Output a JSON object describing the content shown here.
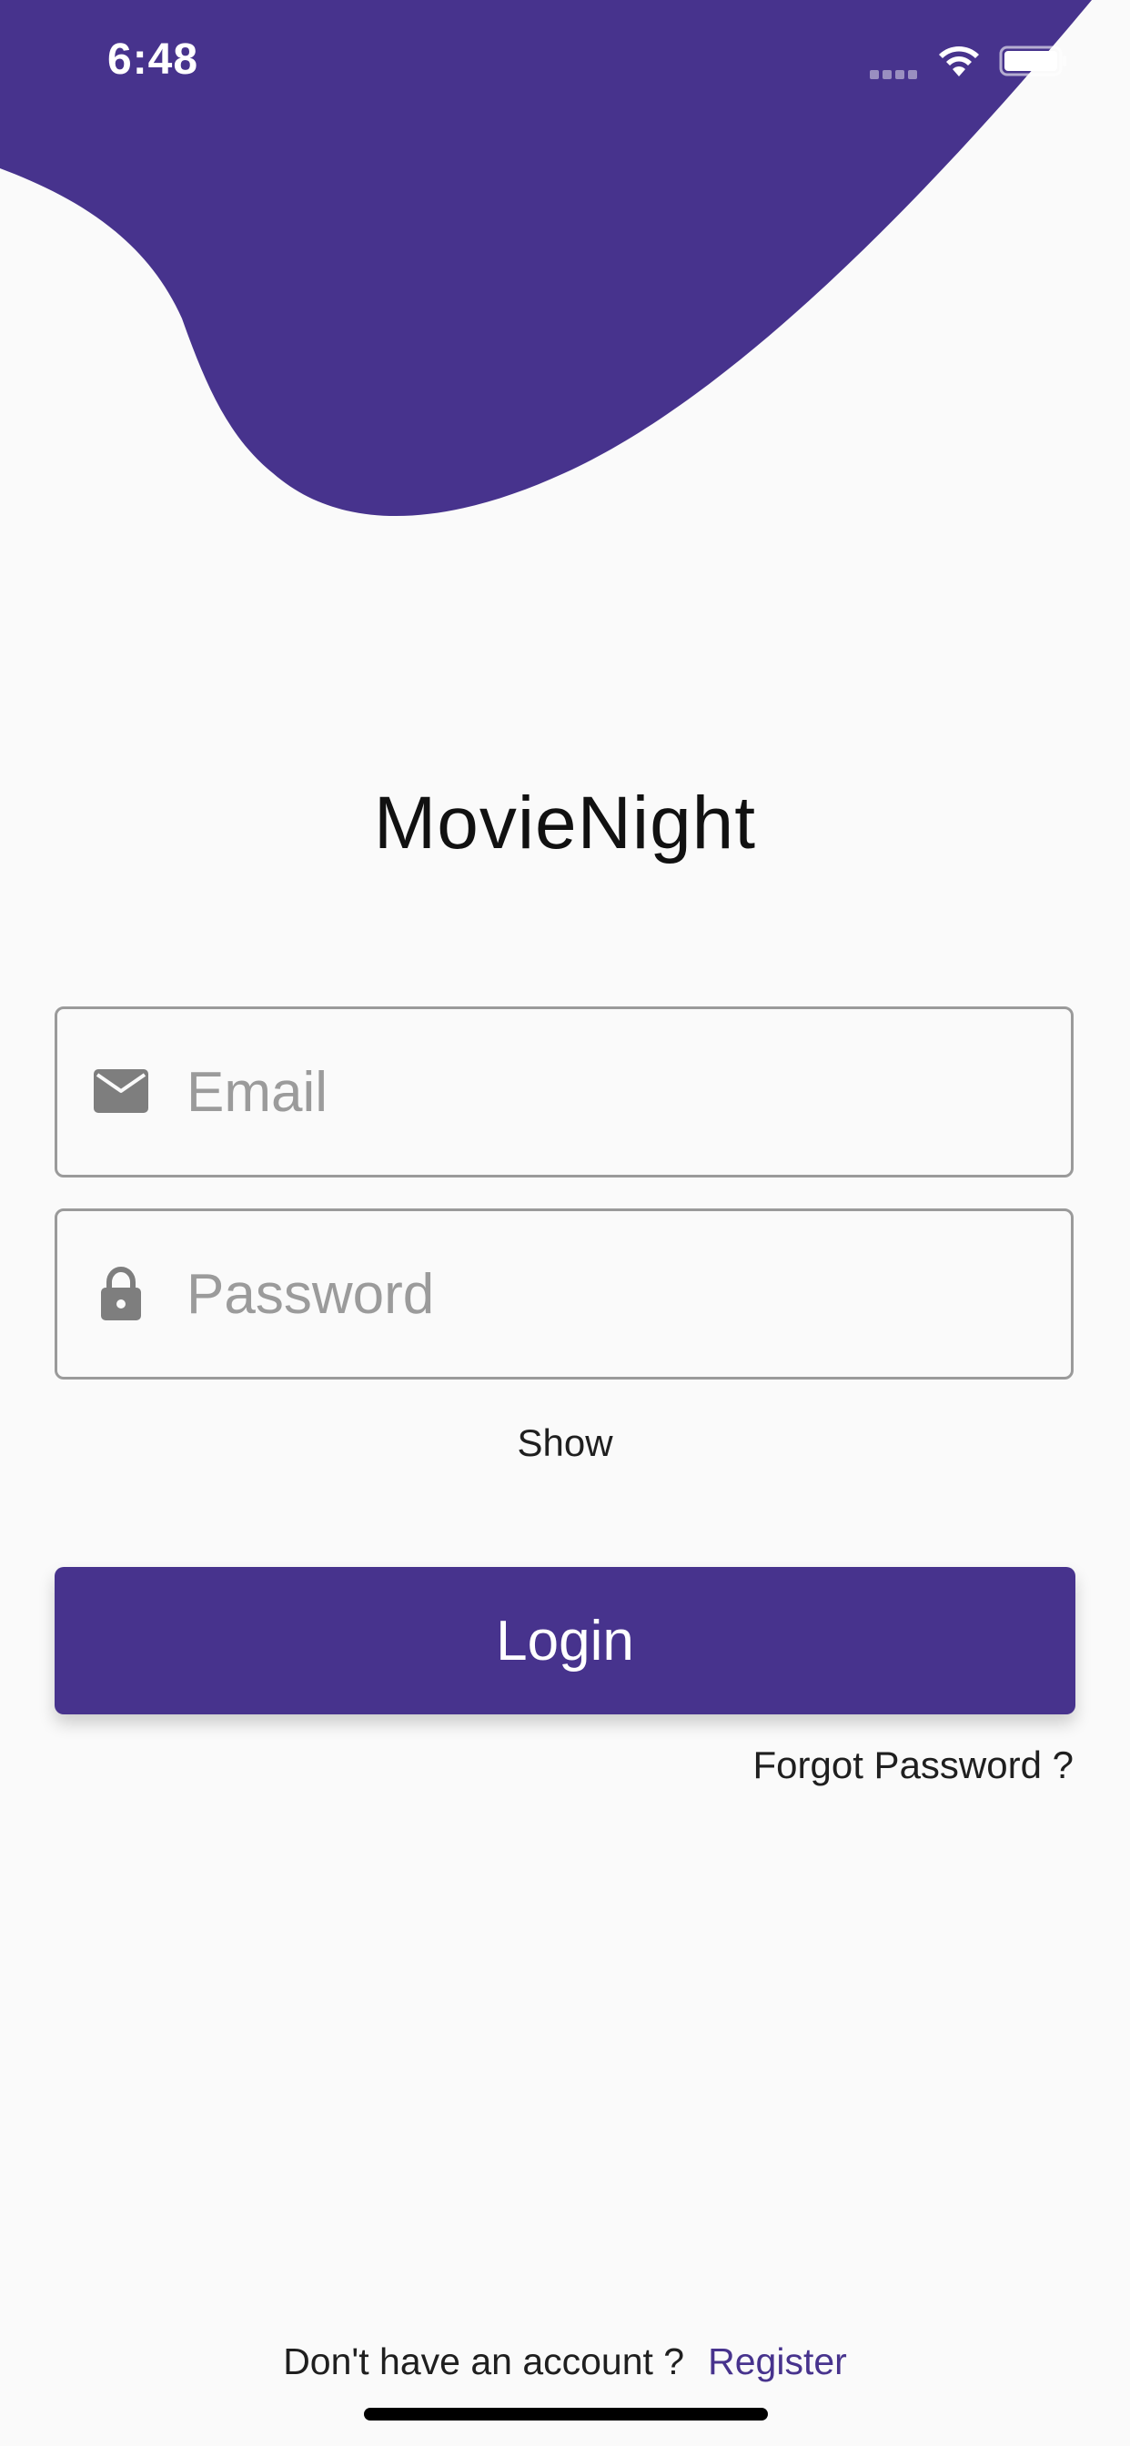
{
  "status_bar": {
    "time": "6:48"
  },
  "app": {
    "title": "MovieNight"
  },
  "form": {
    "email": {
      "placeholder": "Email",
      "value": "",
      "icon": "email-icon"
    },
    "password": {
      "placeholder": "Password",
      "value": "",
      "icon": "lock-icon"
    },
    "show_label": "Show",
    "login_label": "Login",
    "forgot_label": "Forgot Password ?"
  },
  "footer": {
    "prompt": "Don't have an account ?",
    "register_label": "Register"
  },
  "colors": {
    "brand": "#47338d",
    "background": "#fafafa",
    "field_border": "#9a9a9a",
    "placeholder": "#9b9b9b"
  }
}
